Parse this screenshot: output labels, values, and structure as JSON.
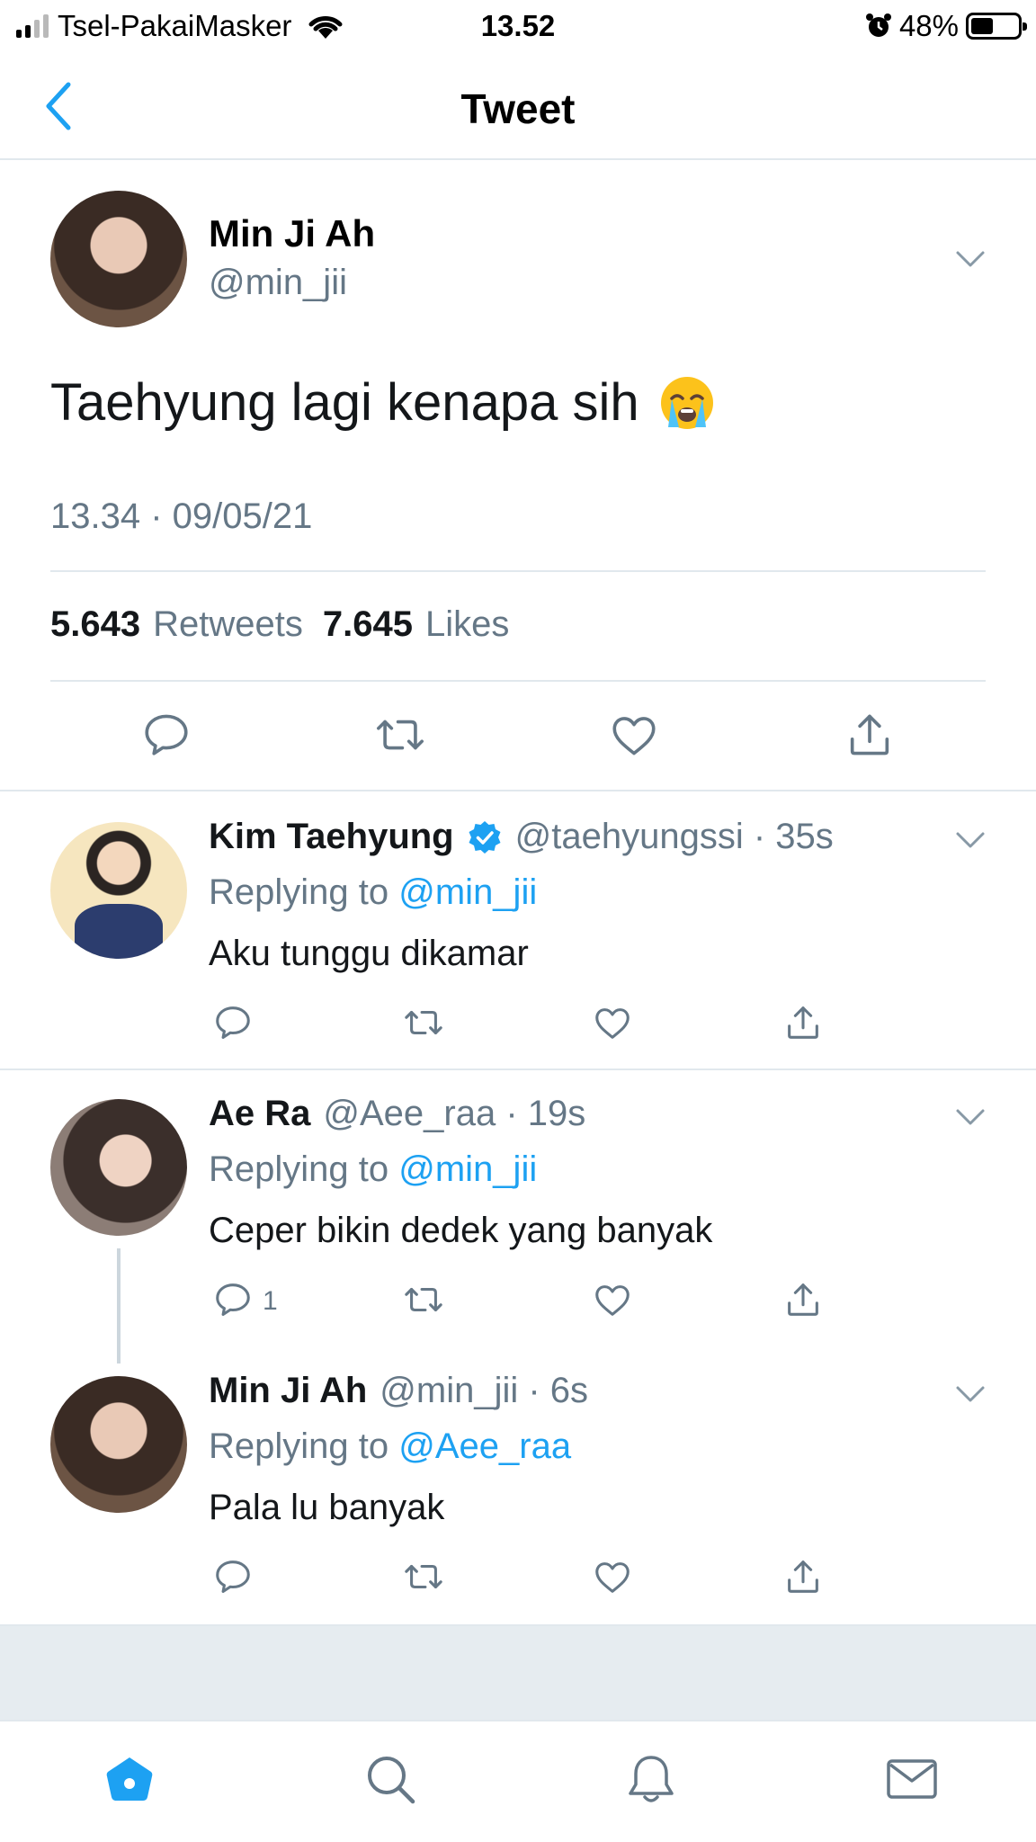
{
  "status_bar": {
    "carrier": "Tsel-PakaiMasker",
    "time": "13.52",
    "battery_percent": "48%",
    "battery_level": 0.48
  },
  "header": {
    "title": "Tweet"
  },
  "main_tweet": {
    "name": "Min Ji Ah",
    "handle": "@min_jii",
    "text": "Taehyung lagi kenapa sih",
    "emoji": "loudly-crying-face-icon",
    "timestamp": "13.34 · 09/05/21",
    "retweets_count": "5.643",
    "retweets_label": "Retweets",
    "likes_count": "7.645",
    "likes_label": "Likes"
  },
  "replies": [
    {
      "name": "Kim Taehyung",
      "verified": true,
      "handle": "@taehyungssi · 35s",
      "replying_prefix": "Replying to",
      "replying_to": "@min_jii",
      "text": "Aku tunggu dikamar",
      "reply_count": ""
    },
    {
      "name": "Ae Ra",
      "verified": false,
      "handle": "@Aee_raa · 19s",
      "replying_prefix": "Replying to",
      "replying_to": "@min_jii",
      "text": "Ceper bikin dedek yang banyak",
      "reply_count": "1"
    },
    {
      "name": "Min Ji Ah",
      "verified": false,
      "handle": "@min_jii · 6s",
      "replying_prefix": "Replying to",
      "replying_to": "@Aee_raa",
      "text": "Pala lu banyak",
      "reply_count": ""
    }
  ],
  "colors": {
    "accent": "#1da1f2",
    "secondary_text": "#657786",
    "divider": "#e1e8ed"
  },
  "tab_bar": [
    "home-icon",
    "search-icon",
    "notifications-icon",
    "messages-icon"
  ]
}
